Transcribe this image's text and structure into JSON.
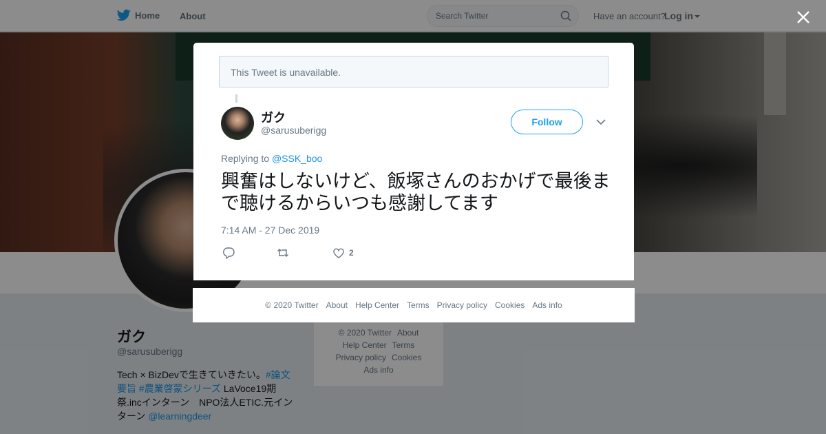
{
  "nav": {
    "home_label": "Home",
    "about_label": "About",
    "search_placeholder": "Search Twitter",
    "have_account": "Have an account?",
    "login_label": "Log in"
  },
  "profile": {
    "name": "ガク",
    "handle": "@sarusuberigg",
    "bio_text_1": "Tech × BizDevで生きていきたい。",
    "bio_link_1": "#論文要旨",
    "bio_link_2": "#農業啓蒙シリーズ",
    "bio_text_2": " LaVoce19期 祭.incインターン　NPO法人ETIC.元インターン ",
    "bio_link_3": "@learningdeer"
  },
  "side_footer": {
    "items": [
      "© 2020 Twitter",
      "About",
      "Help Center",
      "Terms",
      "Privacy policy",
      "Cookies",
      "Ads info"
    ]
  },
  "modal": {
    "unavailable_notice": "This Tweet is unavailable.",
    "author_name": "ガク",
    "author_handle": "@sarusuberigg",
    "follow_label": "Follow",
    "replying_prefix": "Replying to ",
    "replying_handle": "@SSK_boo",
    "tweet_text": "興奮はしないけど、飯塚さんのおかげで最後まで聴けるからいつも感謝してます",
    "timestamp": "7:14 AM - 27 Dec 2019",
    "like_count": "2"
  },
  "modal_footer": {
    "items": [
      "© 2020 Twitter",
      "About",
      "Help Center",
      "Terms",
      "Privacy policy",
      "Cookies",
      "Ads info"
    ]
  },
  "colors": {
    "accent": "#1da1f2",
    "link": "#1b95e0",
    "muted": "#657786"
  }
}
